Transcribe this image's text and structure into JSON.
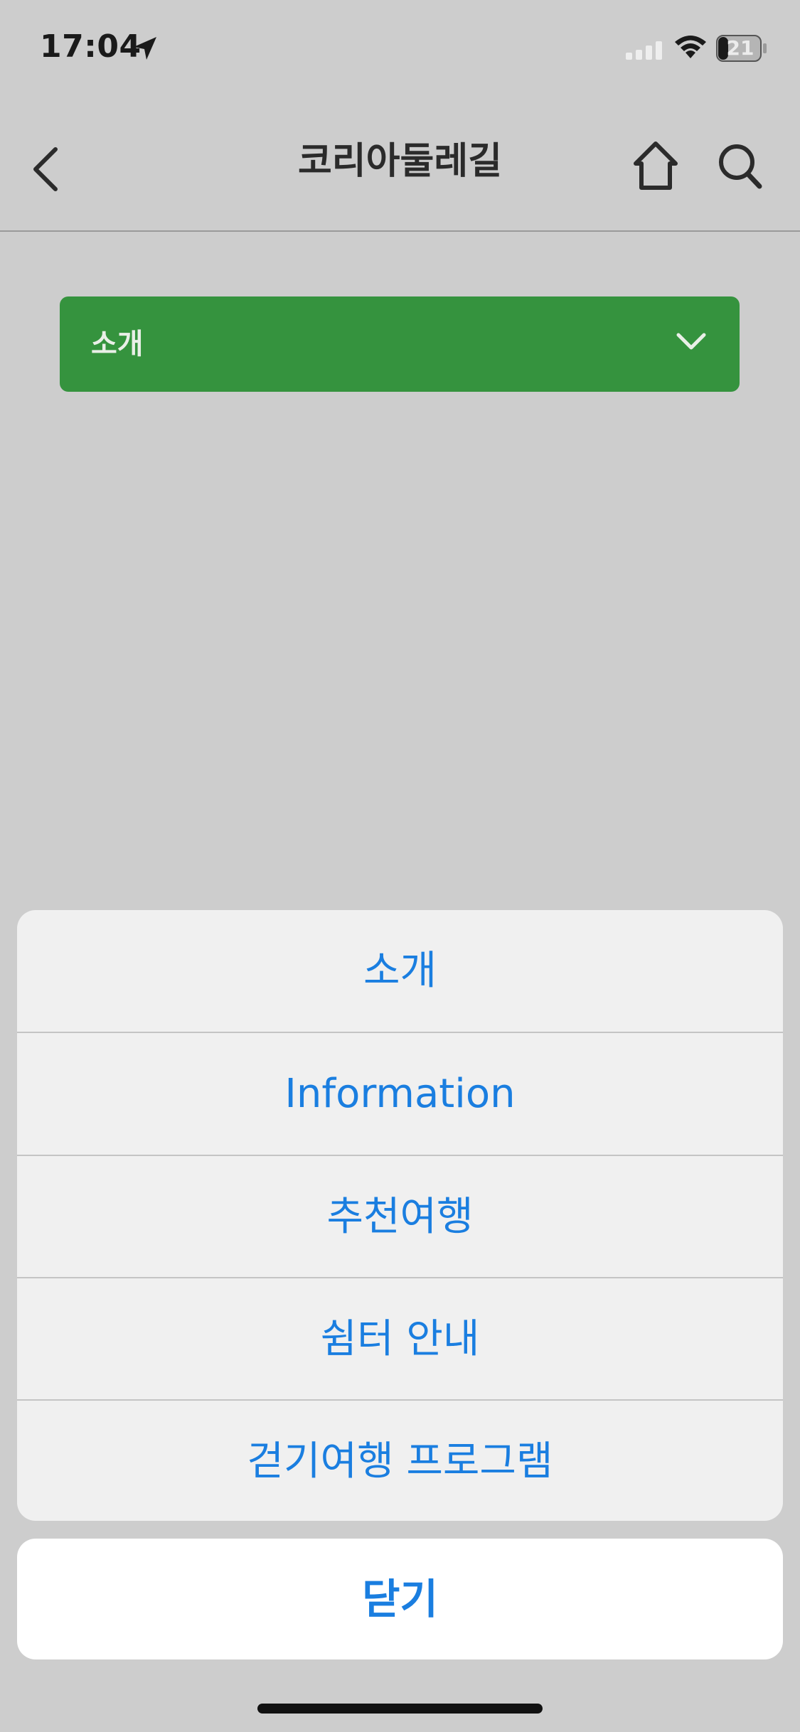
{
  "status_bar": {
    "time": "17:04",
    "battery_level": "21",
    "icons": [
      "location-arrow-icon",
      "cellular-signal-icon",
      "wifi-icon",
      "battery-icon"
    ]
  },
  "header": {
    "title": "코리아둘레길",
    "icons": [
      "back-chevron-icon",
      "home-icon",
      "search-icon"
    ]
  },
  "category_select": {
    "selected_label": "소개"
  },
  "action_sheet": {
    "items": [
      {
        "label": "소개"
      },
      {
        "label": "Information"
      },
      {
        "label": "추천여행"
      },
      {
        "label": "쉼터 안내"
      },
      {
        "label": "걷기여행 프로그램"
      }
    ],
    "cancel_label": "닫기"
  },
  "colors": {
    "background": "#cdcdcd",
    "accent_green": "#35933e",
    "action_blue": "#1a7ee0",
    "sheet_bg": "#f0f0f0"
  }
}
